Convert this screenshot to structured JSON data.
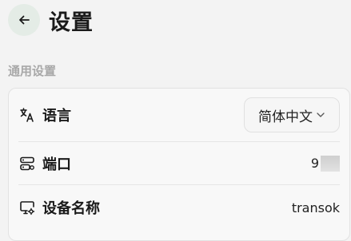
{
  "header": {
    "title": "设置"
  },
  "section": {
    "title": "通用设置"
  },
  "settings": {
    "language": {
      "label": "语言",
      "value": "简体中文"
    },
    "port": {
      "label": "端口",
      "value": "9"
    },
    "device_name": {
      "label": "设备名称",
      "value": "transok"
    }
  },
  "icons": {
    "back": "arrow-left-icon",
    "language": "translate-icon",
    "port": "server-icon",
    "device": "monitor-settings-icon",
    "dropdown": "chevron-down-icon"
  }
}
